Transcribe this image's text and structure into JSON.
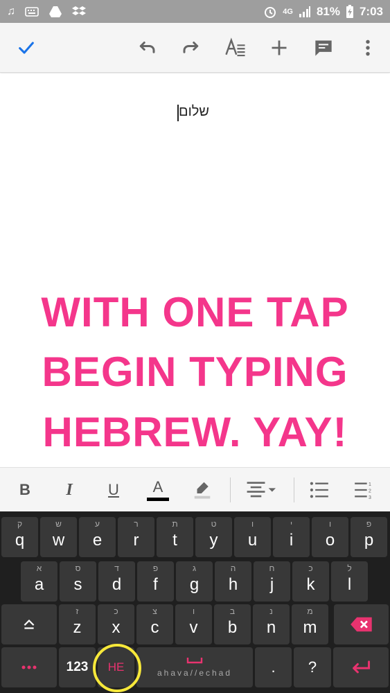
{
  "status_bar": {
    "battery": "81%",
    "time": "7:03",
    "network": "4G"
  },
  "toolbar": {
    "confirm_icon": "check-icon",
    "undo_icon": "undo-icon",
    "redo_icon": "redo-icon",
    "text_format_icon": "text-format-icon",
    "insert_icon": "plus-icon",
    "comment_icon": "comment-icon",
    "more_icon": "more-vert-icon"
  },
  "document": {
    "text": "שלום"
  },
  "promo": {
    "line1": "WITH ONE  TAP",
    "line2": "BEGIN TYPING",
    "line3": "HEBREW. YAY!"
  },
  "format_bar": {
    "bold": "B",
    "italic": "I",
    "underline": "U",
    "text_color": "A"
  },
  "keyboard": {
    "row1": [
      {
        "main": "q",
        "hint": "ק"
      },
      {
        "main": "w",
        "hint": "ש"
      },
      {
        "main": "e",
        "hint": "ע"
      },
      {
        "main": "r",
        "hint": "ר"
      },
      {
        "main": "t",
        "hint": "ת"
      },
      {
        "main": "y",
        "hint": "ט"
      },
      {
        "main": "u",
        "hint": "ו"
      },
      {
        "main": "i",
        "hint": "י"
      },
      {
        "main": "o",
        "hint": "ו"
      },
      {
        "main": "p",
        "hint": "פ"
      }
    ],
    "row2": [
      {
        "main": "a",
        "hint": "א"
      },
      {
        "main": "s",
        "hint": "ס"
      },
      {
        "main": "d",
        "hint": "ד"
      },
      {
        "main": "f",
        "hint": "פ"
      },
      {
        "main": "g",
        "hint": "ג"
      },
      {
        "main": "h",
        "hint": "ה"
      },
      {
        "main": "j",
        "hint": "ח"
      },
      {
        "main": "k",
        "hint": "כ"
      },
      {
        "main": "l",
        "hint": "ל"
      }
    ],
    "row3": [
      {
        "main": "z",
        "hint": "ז"
      },
      {
        "main": "x",
        "hint": "כ"
      },
      {
        "main": "c",
        "hint": "צ"
      },
      {
        "main": "v",
        "hint": "ו"
      },
      {
        "main": "b",
        "hint": "ב"
      },
      {
        "main": "n",
        "hint": "נ"
      },
      {
        "main": "m",
        "hint": "מ"
      }
    ],
    "numbers_label": "123",
    "language_label": "HE",
    "space_label": "ahava//echad",
    "period_label": ".",
    "question_label": "?"
  },
  "colors": {
    "accent_blue": "#1a73e8",
    "promo_pink": "#f4368b",
    "keyboard_pink": "#e8336f",
    "highlight_yellow": "#f7e83a"
  }
}
